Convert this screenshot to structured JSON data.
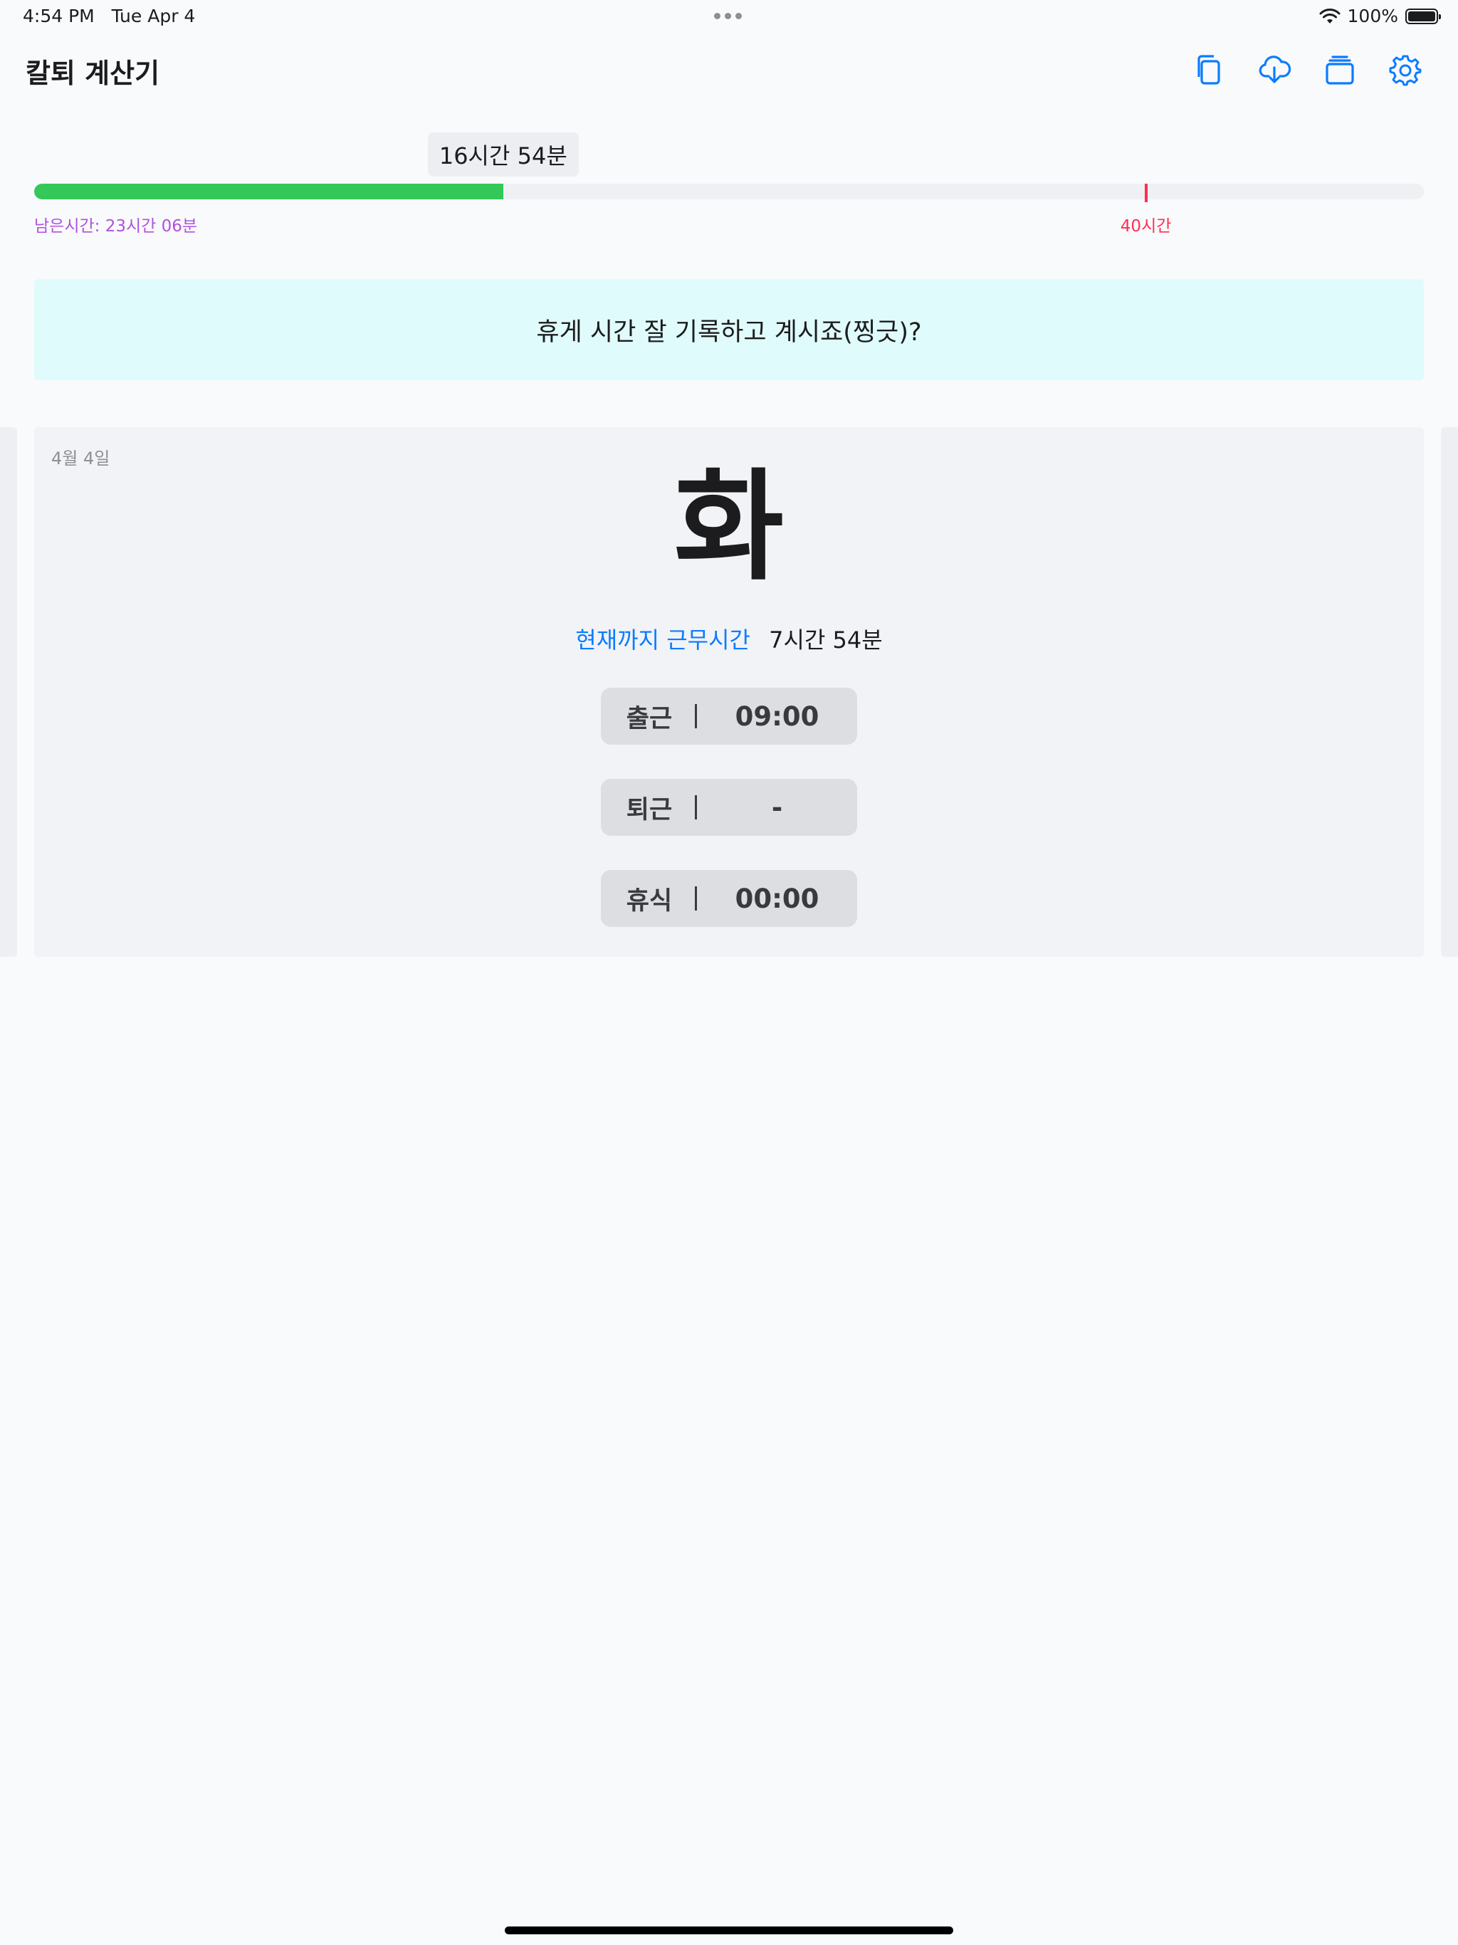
{
  "status_bar": {
    "time": "4:54 PM",
    "date": "Tue Apr 4",
    "battery": "100%"
  },
  "app": {
    "title": "칼퇴 계산기"
  },
  "toolbar": {
    "icons": [
      "copy-icon",
      "cloud-download-icon",
      "stack-icon",
      "gear-icon"
    ],
    "accent": "#0a7cff"
  },
  "week_progress": {
    "elapsed": "16시간 54분",
    "remaining": "남은시간: 23시간 06분",
    "target_label": "40시간",
    "elapsed_fraction": 0.3375,
    "target_fraction": 0.8,
    "fill_color": "#34c759",
    "target_color": "#ff2d55",
    "remaining_color": "#af52de"
  },
  "banner": {
    "text": "휴게 시간 잘 기록하고 계시죠(찡긋)?",
    "background": "#e0fbfb"
  },
  "day_card": {
    "date": "4월 4일",
    "weekday": "화",
    "work_label": "현재까지 근무시간",
    "work_value": "7시간 54분",
    "entries": [
      {
        "label": "출근",
        "value": "09:00"
      },
      {
        "label": "퇴근",
        "value": "-"
      },
      {
        "label": "휴식",
        "value": "00:00"
      }
    ]
  }
}
